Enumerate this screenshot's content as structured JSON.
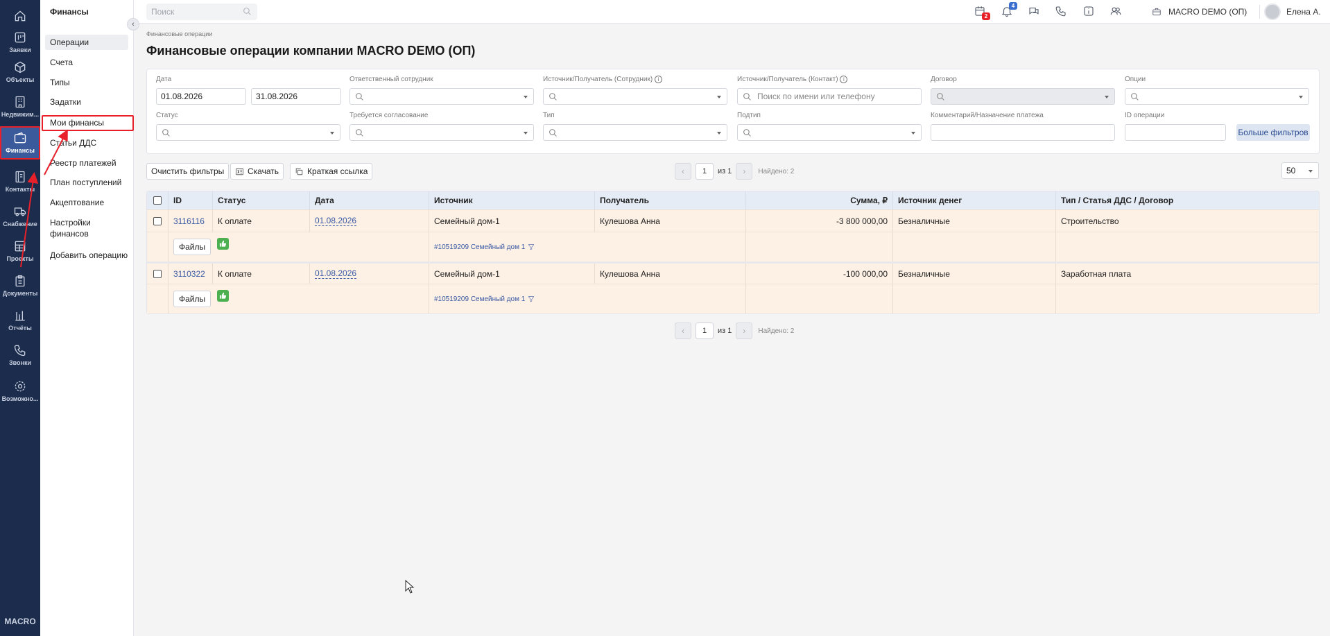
{
  "rail": {
    "items": [
      {
        "key": "home",
        "label": "",
        "icon": "home-icon"
      },
      {
        "key": "requests",
        "label": "Заявки",
        "icon": "kanban-icon"
      },
      {
        "key": "objects",
        "label": "Объекты",
        "icon": "cube-icon"
      },
      {
        "key": "realty",
        "label": "Недвижим...",
        "icon": "building-icon"
      },
      {
        "key": "finance",
        "label": "Финансы",
        "icon": "wallet-icon"
      },
      {
        "key": "contacts",
        "label": "Контакты",
        "icon": "address-book-icon"
      },
      {
        "key": "supply",
        "label": "Снабжение",
        "icon": "truck-icon"
      },
      {
        "key": "projects",
        "label": "Проекты",
        "icon": "grid-icon"
      },
      {
        "key": "documents",
        "label": "Документы",
        "icon": "clipboard-icon"
      },
      {
        "key": "reports",
        "label": "Отчёты",
        "icon": "bar-chart-icon"
      },
      {
        "key": "calls",
        "label": "Звонки",
        "icon": "phone-icon"
      },
      {
        "key": "features",
        "label": "Возможно...",
        "icon": "gear-icon"
      }
    ],
    "logo": "MACRO"
  },
  "sidebar": {
    "title": "Финансы",
    "items": [
      {
        "label": "Операции",
        "active": true
      },
      {
        "label": "Счета"
      },
      {
        "label": "Типы"
      },
      {
        "label": "Задатки"
      },
      {
        "label": "Мои финансы",
        "highlighted": true
      },
      {
        "label": "Статьи ДДС"
      },
      {
        "label": "Реестр платежей"
      },
      {
        "label": "План поступлений"
      },
      {
        "label": "Акцептование"
      },
      {
        "label": "Настройки финансов"
      },
      {
        "label": "Добавить операцию"
      }
    ]
  },
  "topbar": {
    "search_placeholder": "Поиск",
    "calendar_badge": "2",
    "notif_badge": "4",
    "company": "MACRO DEMO (ОП)",
    "user": "Елена А."
  },
  "page": {
    "breadcrumb": "Финансовые операции",
    "title": "Финансовые операции компании MACRO DEMO (ОП)"
  },
  "filters": {
    "date_label": "Дата",
    "date_from": "01.08.2026",
    "date_to": "31.08.2026",
    "responsible_label": "Ответственный сотрудник",
    "src_employee_label": "Источник/Получатель (Сотрудник)",
    "src_contact_label": "Источник/Получатель (Контакт)",
    "src_contact_placeholder": "Поиск по имени или телефону",
    "contract_label": "Договор",
    "options_label": "Опции",
    "status_label": "Статус",
    "approval_label": "Требуется согласование",
    "type_label": "Тип",
    "subtype_label": "Подтип",
    "comment_label": "Комментарий/Назначение платежа",
    "op_id_label": "ID операции",
    "more_filters": "Больше фильтров"
  },
  "toolbar": {
    "clear": "Очистить фильтры",
    "download": "Скачать",
    "short_link": "Краткая ссылка",
    "page": "1",
    "of": "из 1",
    "found": "Найдено: 2",
    "per_page": "50"
  },
  "table": {
    "headers": {
      "id": "ID",
      "status": "Статус",
      "date": "Дата",
      "source": "Источник",
      "recipient": "Получатель",
      "sum": "Сумма, ₽",
      "money_source": "Источник денег",
      "type": "Тип / Статья ДДС / Договор"
    },
    "files_label": "Файлы",
    "rows": [
      {
        "id": "3116116",
        "status": "К оплате",
        "date": "01.08.2026",
        "source": "Семейный дом-1",
        "recipient": "Кулешова Анна",
        "sum": "-3 800 000,00",
        "money_source": "Безналичные",
        "type": "Строительство",
        "contract": "#10519209 Семейный дом 1"
      },
      {
        "id": "3110322",
        "status": "К оплате",
        "date": "01.08.2026",
        "source": "Семейный дом-1",
        "recipient": "Кулешова Анна",
        "sum": "-100 000,00",
        "money_source": "Безналичные",
        "type": "Заработная плата",
        "contract": "#10519209 Семейный дом 1"
      }
    ]
  },
  "colors": {
    "rail_bg": "#1c2c4c",
    "rail_active": "#3a5a9c",
    "accent": "#3a5aa6",
    "row_bg": "#fdf0e4",
    "approve_green": "#4caf50",
    "highlight_red": "#e8202a"
  }
}
